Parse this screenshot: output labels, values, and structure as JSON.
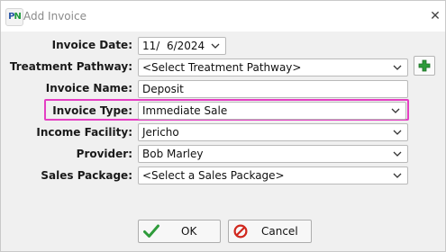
{
  "window": {
    "title": "Add Invoice"
  },
  "app_logo": {
    "text_p": "P",
    "text_n": "N"
  },
  "form": {
    "invoice_date": {
      "label": "Invoice Date:",
      "value": "11/  6/2024"
    },
    "treatment_pathway": {
      "label": "Treatment Pathway:",
      "value": "<Select Treatment Pathway>"
    },
    "invoice_name": {
      "label": "Invoice Name:",
      "value": "Deposit"
    },
    "invoice_type": {
      "label": "Invoice Type:",
      "value": "Immediate Sale"
    },
    "income_facility": {
      "label": "Income Facility:",
      "value": "Jericho"
    },
    "provider": {
      "label": "Provider:",
      "value": "Bob Marley"
    },
    "sales_package": {
      "label": "Sales Package:",
      "value": "<Select a Sales Package>"
    }
  },
  "buttons": {
    "ok_label": "OK",
    "cancel_label": "Cancel"
  },
  "colors": {
    "highlight": "#e43fc3",
    "add_icon": "#2e9b3a",
    "ok_icon": "#2e9b3a",
    "cancel_icon": "#d0271d"
  },
  "icons": {
    "add": "plus-icon",
    "ok": "checkmark-icon",
    "cancel": "no-entry-icon",
    "dropdown": "chevron-down-icon",
    "close": "close-icon"
  }
}
